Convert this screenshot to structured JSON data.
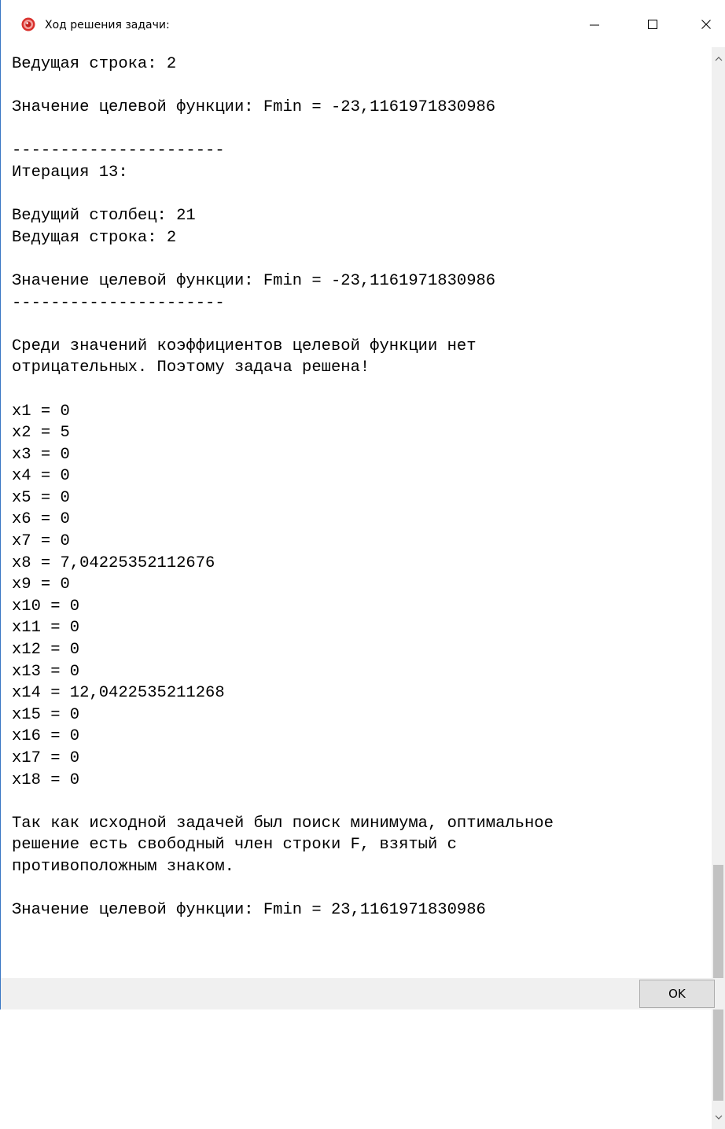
{
  "window": {
    "title": "Ход решения задачи:",
    "icon": "app-record-icon",
    "minimize_glyph": "—",
    "maximize_glyph": "☐",
    "close_glyph": "✕"
  },
  "text_lines": [
    "Ведущая строка: 2",
    "",
    "Значение целевой функции: Fmin = -23,1161971830986",
    "",
    "----------------------",
    "Итерация 13:",
    "",
    "Ведущий столбец: 21",
    "Ведущая строка: 2",
    "",
    "Значение целевой функции: Fmin = -23,1161971830986",
    "----------------------",
    "",
    "Среди значений коэффициентов целевой функции нет",
    "отрицательных. Поэтому задача решена!",
    "",
    "x1 = 0",
    "x2 = 5",
    "x3 = 0",
    "x4 = 0",
    "x5 = 0",
    "x6 = 0",
    "x7 = 0",
    "x8 = 7,04225352112676",
    "x9 = 0",
    "x10 = 0",
    "x11 = 0",
    "x12 = 0",
    "x13 = 0",
    "x14 = 12,0422535211268",
    "x15 = 0",
    "x16 = 0",
    "x17 = 0",
    "x18 = 0",
    "",
    "Так как исходной задачей был поиск минимума, оптимальное",
    "решение есть свободный член строки F, взятый с",
    "противоположным знаком.",
    "",
    "Значение целевой функции: Fmin = 23,1161971830986"
  ],
  "footer": {
    "ok_label": "OK"
  },
  "colors": {
    "window_border": "#3a77c4",
    "background": "#ffffff",
    "footer_bg": "#f0f0f0",
    "button_bg": "#e1e1e1",
    "icon_red": "#d9302c"
  }
}
